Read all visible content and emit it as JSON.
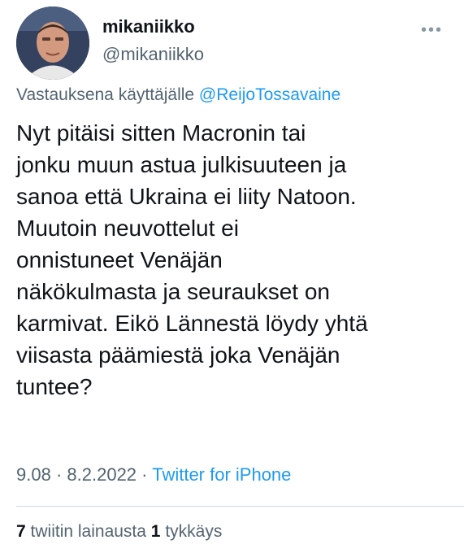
{
  "author": {
    "display_name": "mikaniikko",
    "handle": "@mikaniikko"
  },
  "more_icon": "more-icon",
  "reply": {
    "prefix": "Vastauksena käyttäjälle",
    "mention": "@ReijoTossavaine"
  },
  "tweet_lines": [
    "Nyt pitäisi sitten Macronin tai",
    "jonku muun astua julkisuuteen ja",
    "sanoa että Ukraina ei liity Natoon.",
    "Muutoin neuvottelut ei",
    "onnistuneet Venäjän",
    "näkökulmasta ja seuraukset on",
    "karmivat. Eikö Lännestä löydy yhtä",
    "viisasta päämiestä joka Venäjän",
    "tuntee?"
  ],
  "meta": {
    "time": "9.08",
    "sep1": "·",
    "date": "8.2.2022",
    "sep2": "·",
    "source": "Twitter for iPhone"
  },
  "stats": {
    "quotes_count": "7",
    "quotes_label": "twiitin lainausta",
    "likes_count": "1",
    "likes_label": "tykkäys"
  },
  "colors": {
    "accent": "#1d9bf0",
    "secondary_text": "#536471",
    "primary_text": "#0f1419"
  }
}
